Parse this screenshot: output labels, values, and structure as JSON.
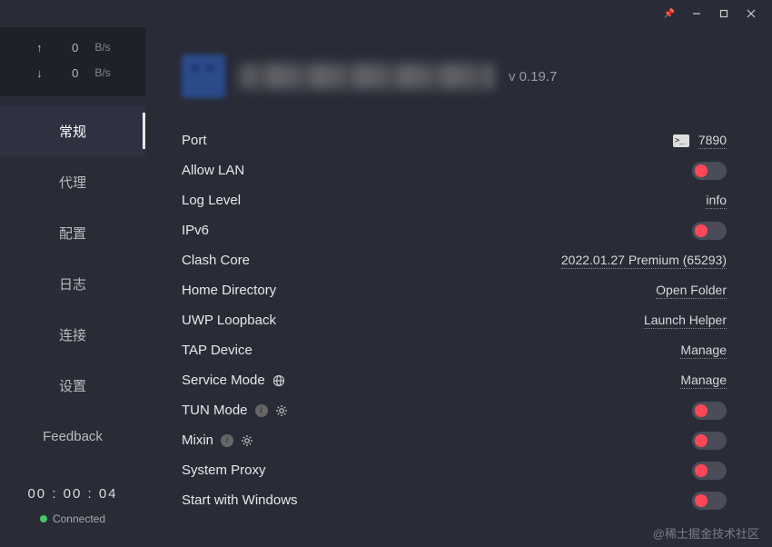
{
  "window": {
    "pin": "📌"
  },
  "net": {
    "up_arrow": "↑",
    "up_value": "0",
    "up_unit": "B/s",
    "down_arrow": "↓",
    "down_value": "0",
    "down_unit": "B/s"
  },
  "nav": {
    "items": [
      {
        "label": "常规"
      },
      {
        "label": "代理"
      },
      {
        "label": "配置"
      },
      {
        "label": "日志"
      },
      {
        "label": "连接"
      },
      {
        "label": "设置"
      },
      {
        "label": "Feedback"
      }
    ]
  },
  "status": {
    "uptime": "00 : 00 : 04",
    "connected_label": "Connected"
  },
  "header": {
    "version": "v 0.19.7"
  },
  "settings": {
    "port": {
      "label": "Port",
      "value": "7890"
    },
    "allow_lan": {
      "label": "Allow LAN",
      "on": false
    },
    "log_level": {
      "label": "Log Level",
      "value": "info"
    },
    "ipv6": {
      "label": "IPv6",
      "on": false
    },
    "clash_core": {
      "label": "Clash Core",
      "value": "2022.01.27 Premium (65293)"
    },
    "home_dir": {
      "label": "Home Directory",
      "value": "Open Folder"
    },
    "uwp": {
      "label": "UWP Loopback",
      "value": "Launch Helper"
    },
    "tap": {
      "label": "TAP Device",
      "value": "Manage"
    },
    "service_mode": {
      "label": "Service Mode",
      "value": "Manage"
    },
    "tun_mode": {
      "label": "TUN Mode",
      "on": false
    },
    "mixin": {
      "label": "Mixin",
      "on": false
    },
    "system_proxy": {
      "label": "System Proxy",
      "on": false
    },
    "start_with": {
      "label": "Start with Windows",
      "on": false
    }
  },
  "watermark": "@稀土掘金技术社区"
}
